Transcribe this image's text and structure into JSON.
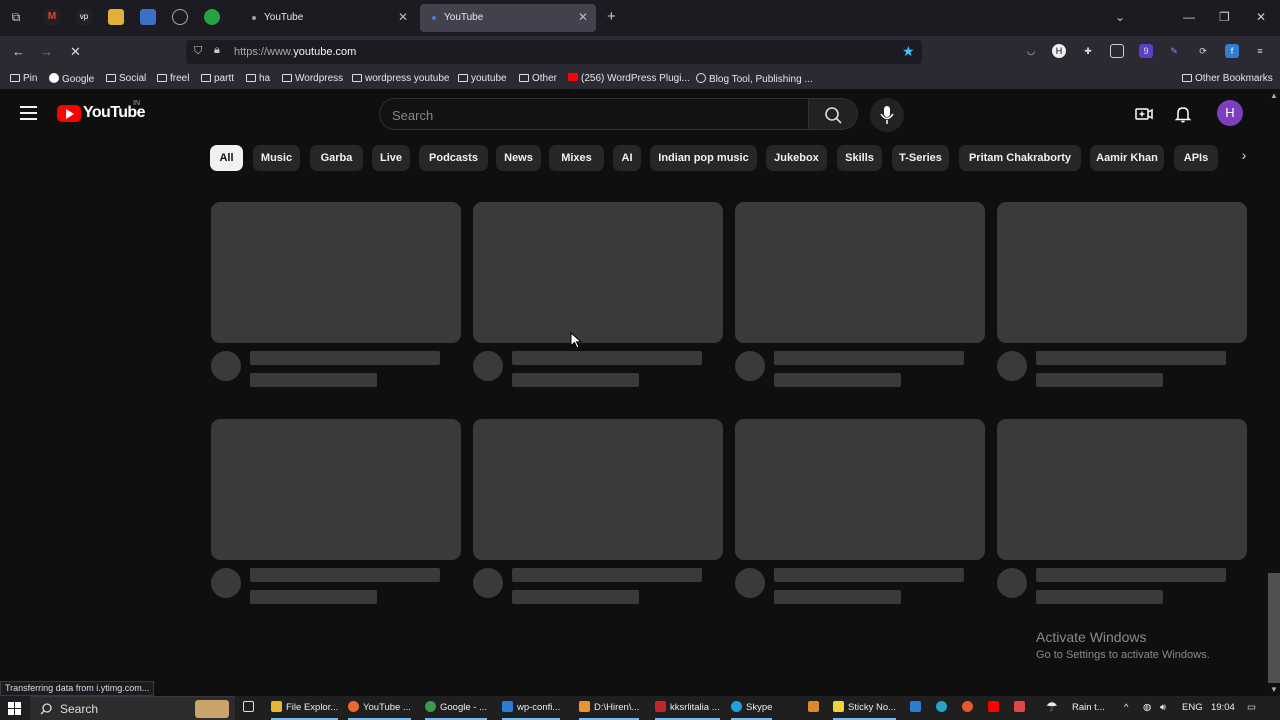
{
  "browser": {
    "tabs": [
      {
        "title": "YouTube",
        "active": false
      },
      {
        "title": "YouTube",
        "active": true
      }
    ],
    "url_prefix": "https://www.",
    "url_domain": "youtube.com",
    "url_path": "",
    "bookmarks": [
      "Pin",
      "Google",
      "Social",
      "freel",
      "partt",
      "ha",
      "Wordpress",
      "wordpress youtube",
      "youtube",
      "Other",
      "(256) WordPress Plugi...",
      "Blog Tool, Publishing ...",
      "Other Bookmarks"
    ],
    "status_text": "Transferring data from i.ytimg.com..."
  },
  "youtube": {
    "logo_text": "YouTube",
    "country_code": "IN",
    "search_placeholder": "Search",
    "avatar_letter": "H",
    "chips": [
      "All",
      "Music",
      "Garba",
      "Live",
      "Podcasts",
      "News",
      "Mixes",
      "AI",
      "Indian pop music",
      "Jukebox",
      "Skills",
      "T-Series",
      "Pritam Chakraborty",
      "Aamir Khan",
      "APIs"
    ],
    "active_chip": "All"
  },
  "watermark": {
    "title": "Activate Windows",
    "subtitle": "Go to Settings to activate Windows."
  },
  "taskbar": {
    "search_label": "Search",
    "apps": [
      "File Explor...",
      "YouTube ...",
      "Google - ...",
      "wp-confi...",
      "D:\\Hiren\\...",
      "kksrlitalia ...",
      "Skype",
      "Sticky No..."
    ],
    "weather": "Rain t...",
    "language": "ENG",
    "time": "19:04"
  },
  "colors": {
    "accent_red": "#ff0000",
    "avatar_bg": "#7b3fbf",
    "background": "#0f0f0f",
    "skeleton": "#3a3a3a"
  }
}
